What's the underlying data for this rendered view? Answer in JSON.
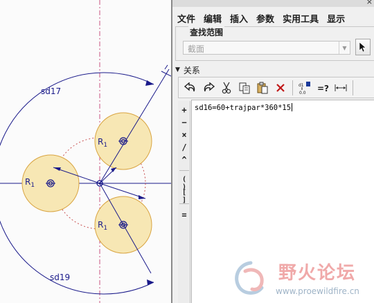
{
  "canvas": {
    "dimensions": [
      "sd17",
      "sd19"
    ],
    "radius_label": "R",
    "radius_subscript": "1",
    "sketch_color": "#1a1a8a",
    "circle_fill": "#f7e7b4",
    "circle_stroke": "#d9a441",
    "construction_color": "#c85050"
  },
  "dialog": {
    "close_glyph": "×",
    "menu": [
      "文件",
      "编辑",
      "插入",
      "参数",
      "实用工具",
      "显示"
    ],
    "search_scope": {
      "title": "查找范围",
      "dropdown_value": "截面",
      "pick_icon": "arrow-select-icon"
    },
    "relations": {
      "label": "关系",
      "toolbar_icons": [
        "undo-icon",
        "redo-icon",
        "cut-icon",
        "copy-icon",
        "paste-icon",
        "delete-icon",
        "evaluate-icon",
        "verify-icon",
        "sort-icon"
      ]
    },
    "operators": [
      "+",
      "−",
      "×",
      "/",
      "^",
      "( )",
      "[ ]",
      "="
    ],
    "relation_text": "sd16=60+trajpar*360*15"
  },
  "watermark": {
    "title": "野火论坛",
    "url": "www.proewildfire.cn"
  }
}
